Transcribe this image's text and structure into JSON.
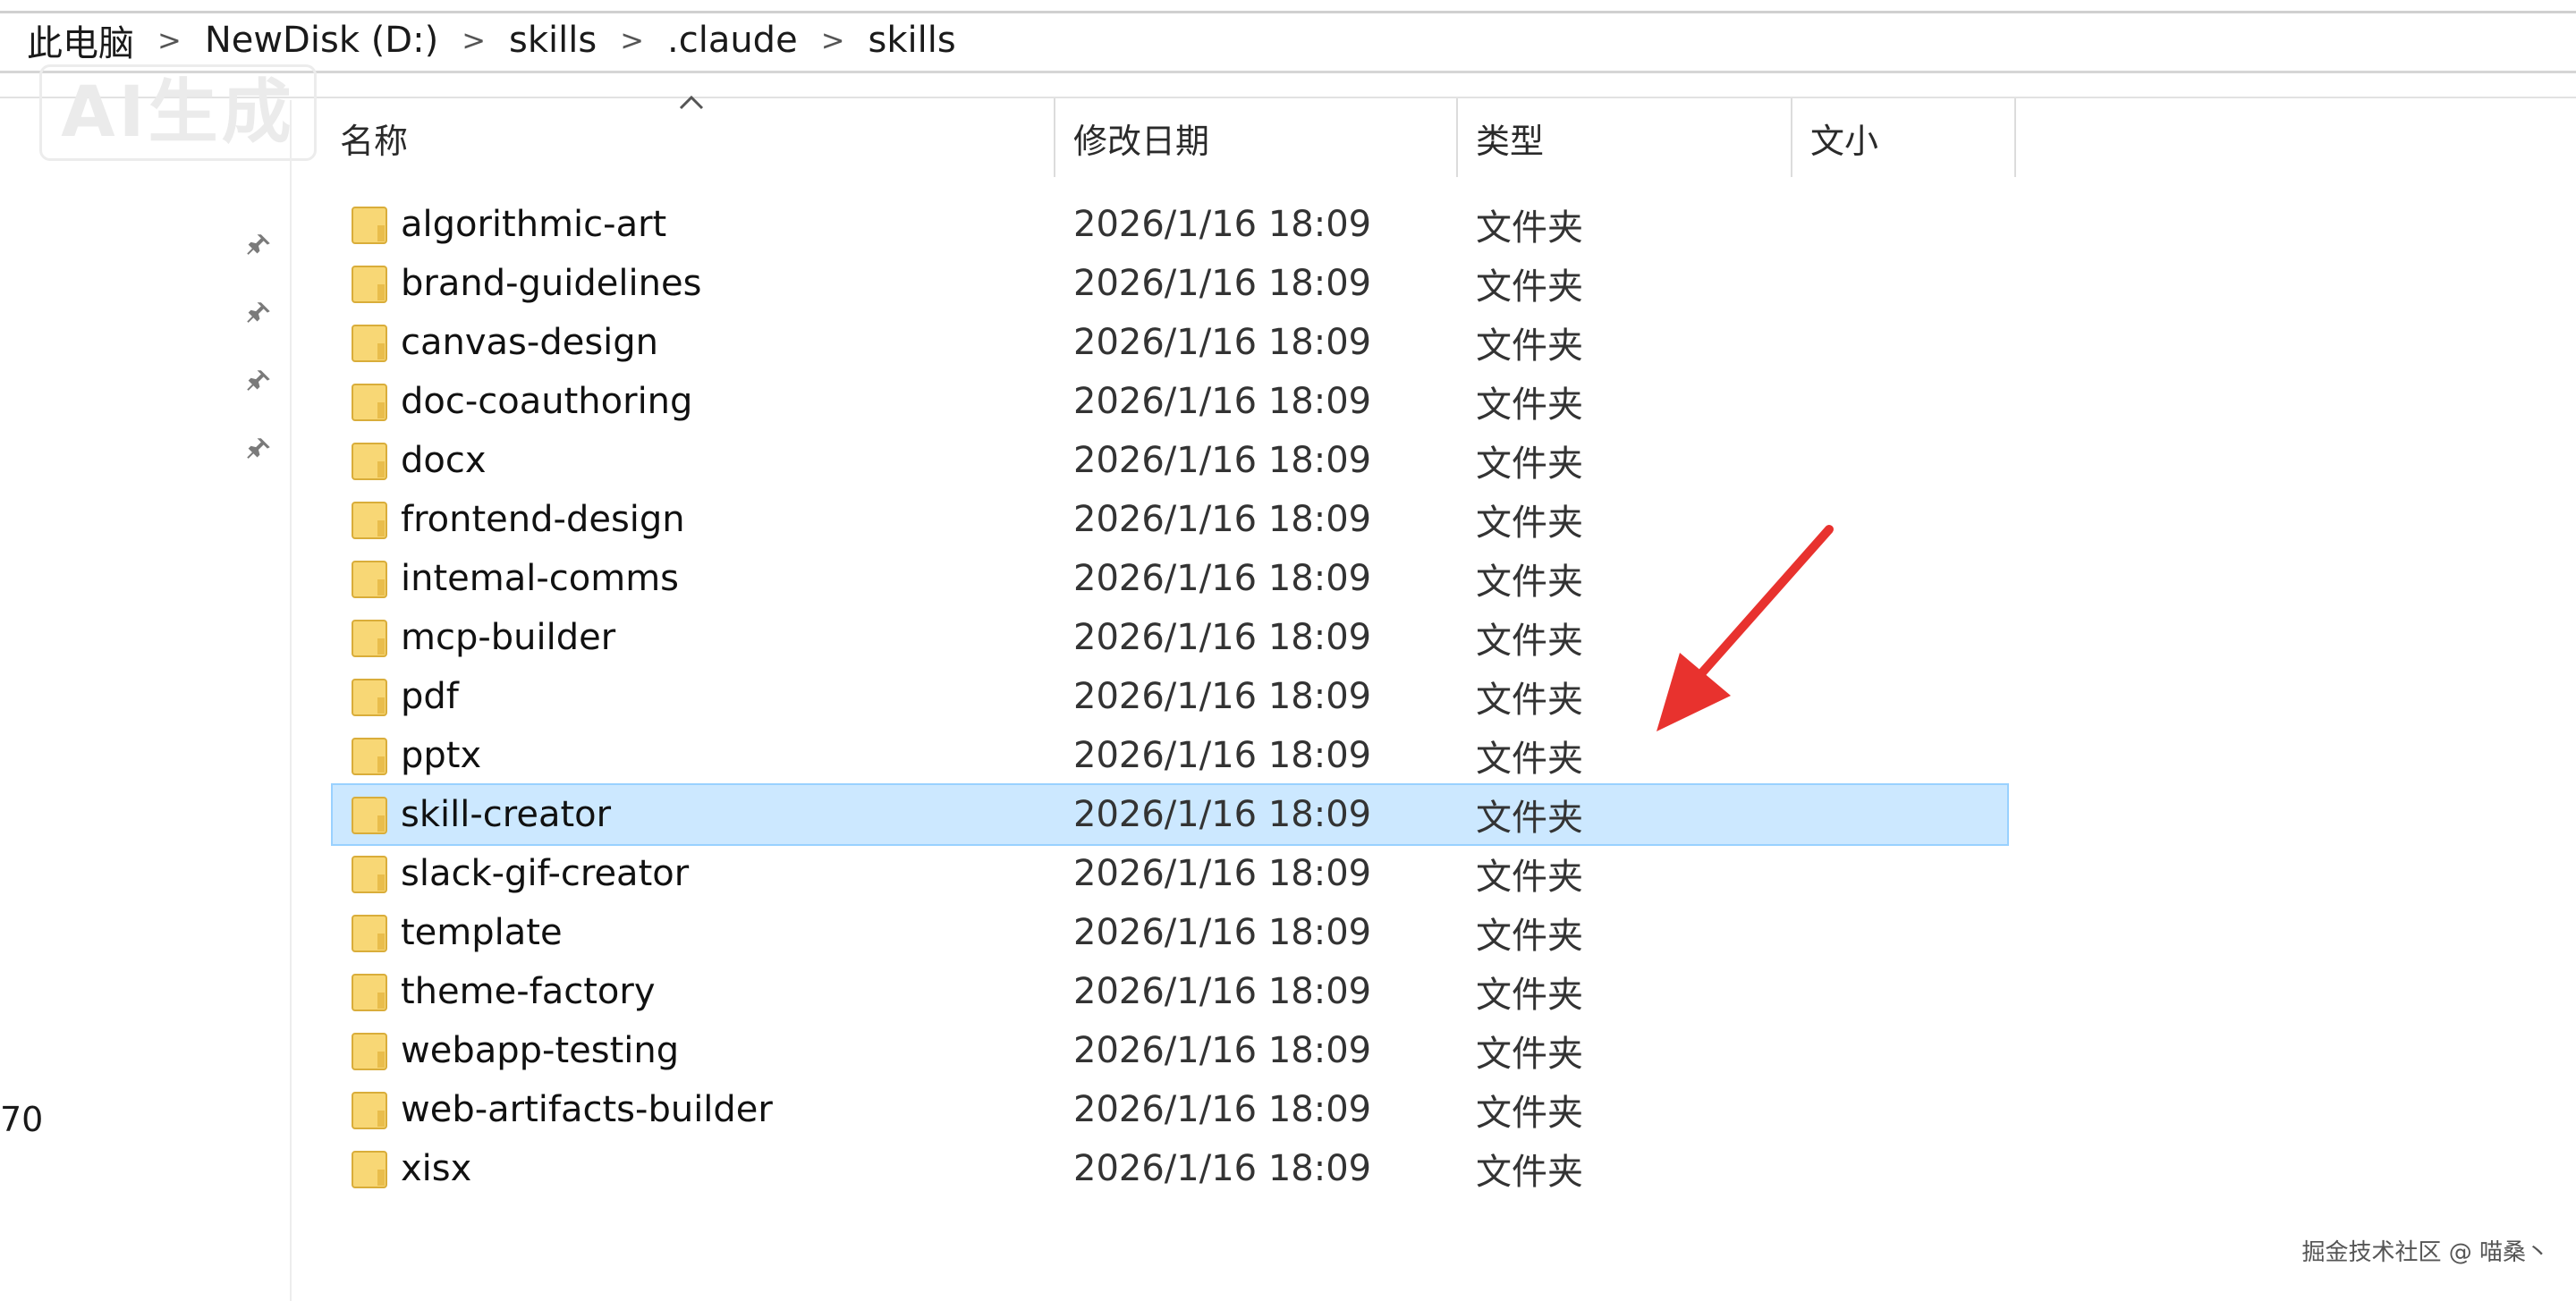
{
  "breadcrumbs": [
    "此电脑",
    "NewDisk (D:)",
    "skills",
    ".claude",
    "skills"
  ],
  "breadcrumb_separator": ">",
  "watermark": "AI生成",
  "nav": {
    "partial_number": "70",
    "pin_icons": 4
  },
  "columns": {
    "name": "名称",
    "date": "修改日期",
    "type": "类型",
    "size": "文小"
  },
  "files": [
    {
      "name": "algorithmic-art",
      "date": "2026/1/16 18:09",
      "type": "文件夹"
    },
    {
      "name": "brand-guidelines",
      "date": "2026/1/16 18:09",
      "type": "文件夹"
    },
    {
      "name": "canvas-design",
      "date": "2026/1/16 18:09",
      "type": "文件夹"
    },
    {
      "name": "doc-coauthoring",
      "date": "2026/1/16 18:09",
      "type": "文件夹"
    },
    {
      "name": "docx",
      "date": "2026/1/16 18:09",
      "type": "文件夹"
    },
    {
      "name": "frontend-design",
      "date": "2026/1/16 18:09",
      "type": "文件夹"
    },
    {
      "name": "intemal-comms",
      "date": "2026/1/16 18:09",
      "type": "文件夹"
    },
    {
      "name": "mcp-builder",
      "date": "2026/1/16 18:09",
      "type": "文件夹"
    },
    {
      "name": "pdf",
      "date": "2026/1/16 18:09",
      "type": "文件夹"
    },
    {
      "name": "pptx",
      "date": "2026/1/16 18:09",
      "type": "文件夹"
    },
    {
      "name": "skill-creator",
      "date": "2026/1/16 18:09",
      "type": "文件夹",
      "selected": true
    },
    {
      "name": "slack-gif-creator",
      "date": "2026/1/16 18:09",
      "type": "文件夹"
    },
    {
      "name": "template",
      "date": "2026/1/16 18:09",
      "type": "文件夹"
    },
    {
      "name": "theme-factory",
      "date": "2026/1/16 18:09",
      "type": "文件夹"
    },
    {
      "name": "webapp-testing",
      "date": "2026/1/16 18:09",
      "type": "文件夹"
    },
    {
      "name": "web-artifacts-builder",
      "date": "2026/1/16 18:09",
      "type": "文件夹"
    },
    {
      "name": "xisx",
      "date": "2026/1/16 18:09",
      "type": "文件夹"
    }
  ],
  "footer_watermark": "掘金技术社区 @ 喵桑丶",
  "colors": {
    "selection": "#cce8ff",
    "selection_border": "#99d1ff",
    "folder": "#f8d775",
    "arrow": "#e8322e"
  }
}
